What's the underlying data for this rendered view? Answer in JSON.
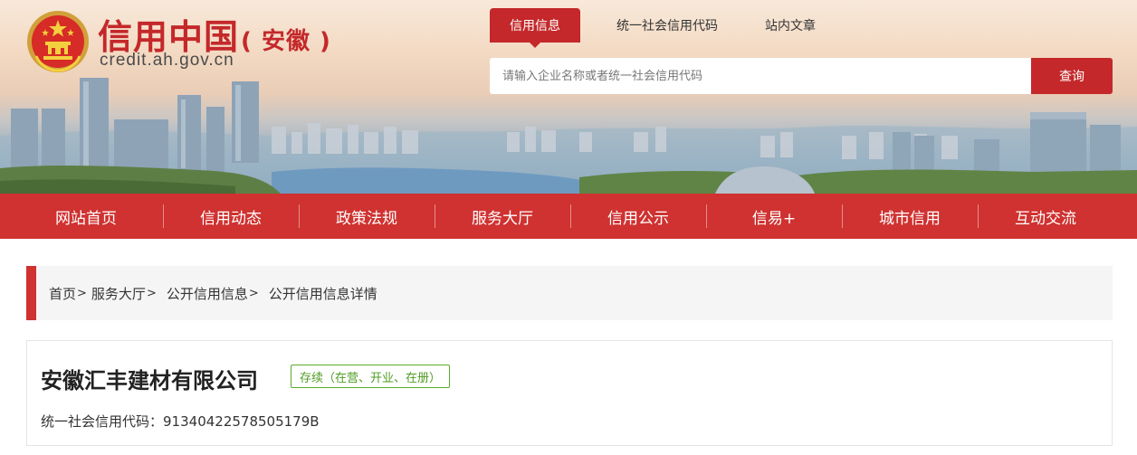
{
  "header": {
    "logo_title": "信用中国",
    "logo_subtitle": "( 安徽 )",
    "logo_url": "credit.ah.gov.cn",
    "top_tabs": [
      {
        "label": "信用信息",
        "active": true
      },
      {
        "label": "统一社会信用代码",
        "active": false
      },
      {
        "label": "站内文章",
        "active": false
      }
    ],
    "search": {
      "placeholder": "请输入企业名称或者统一社会信用代码",
      "value": "",
      "button_label": "查询"
    }
  },
  "nav": {
    "items": [
      {
        "label": "网站首页"
      },
      {
        "label": "信用动态"
      },
      {
        "label": "政策法规"
      },
      {
        "label": "服务大厅"
      },
      {
        "label": "信用公示"
      },
      {
        "label": "信易+"
      },
      {
        "label": "城市信用"
      },
      {
        "label": "互动交流"
      }
    ]
  },
  "breadcrumb": {
    "items": [
      "首页",
      "服务大厅",
      "公开信用信息",
      "公开信用信息详情"
    ],
    "separator": ">"
  },
  "company": {
    "name": "安徽汇丰建材有限公司",
    "status": "存续（在营、开业、在册）",
    "credit_code_label": "统一社会信用代码：",
    "credit_code": "91340422578505179B"
  },
  "colors": {
    "brand_red": "#c4282a",
    "nav_red": "#cf3230",
    "status_green": "#5bab2a"
  },
  "icons": {
    "logo": "national-emblem-icon"
  }
}
